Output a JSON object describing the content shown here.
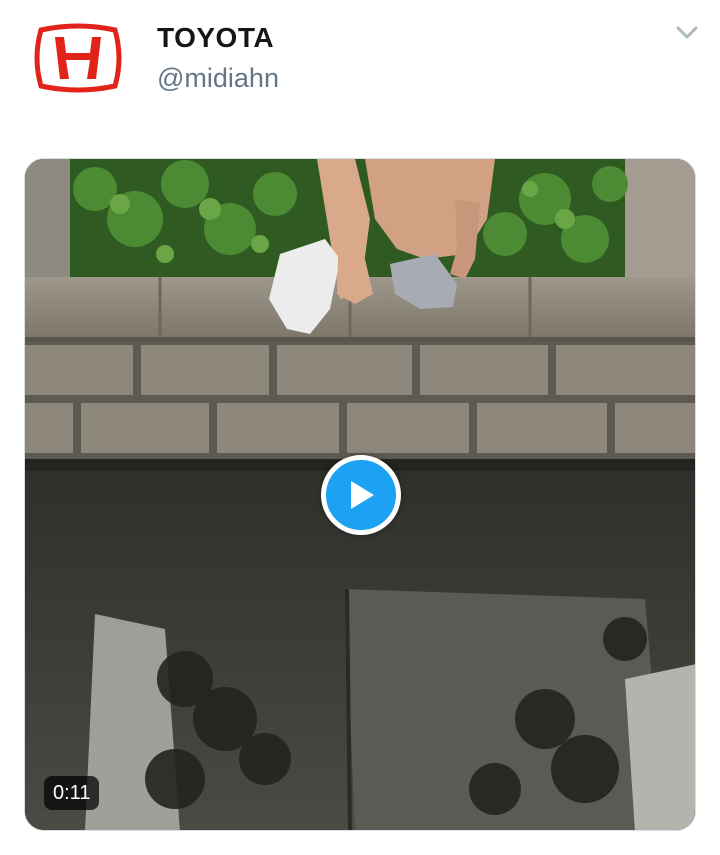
{
  "tweet": {
    "author": {
      "display_name": "TOYOTA",
      "handle": "@midiahn",
      "avatar_icon": "honda-logo-icon",
      "avatar_color": "#e2231a"
    },
    "menu_icon": "chevron-down-icon",
    "media": {
      "type": "video",
      "duration": "0:11",
      "play_icon": "play-icon",
      "accent_color": "#1da1f2"
    }
  }
}
